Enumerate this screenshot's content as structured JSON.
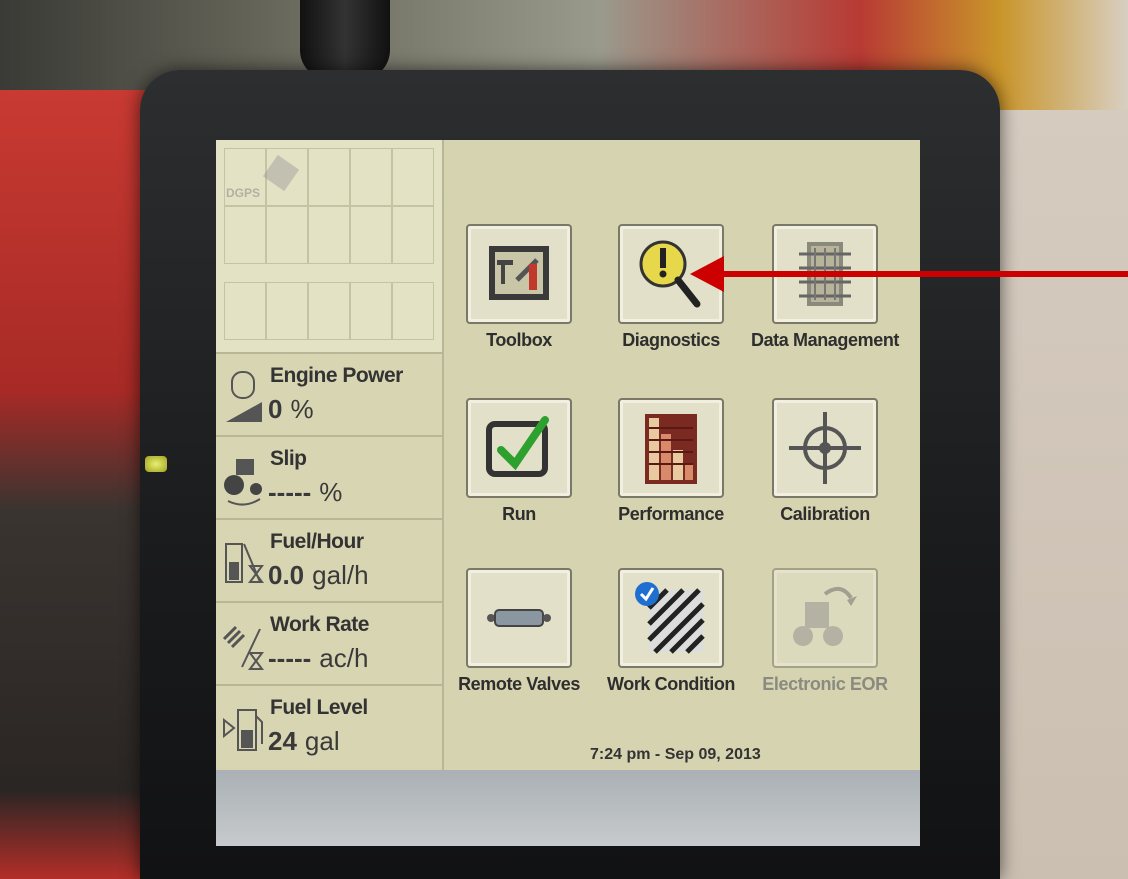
{
  "gps": {
    "label": "DGPS"
  },
  "metrics": [
    {
      "label": "Engine Power",
      "value": "0",
      "unit": "%",
      "icon": "engine-icon"
    },
    {
      "label": "Slip",
      "value": "-----",
      "unit": "%",
      "icon": "tractor-slip-icon"
    },
    {
      "label": "Fuel/Hour",
      "value": "0.0",
      "unit": "gal/h",
      "icon": "fuel-pump-hourglass-icon"
    },
    {
      "label": "Work Rate",
      "value": "-----",
      "unit": "ac/h",
      "icon": "field-hourglass-icon"
    },
    {
      "label": "Fuel Level",
      "value": "24",
      "unit": "gal",
      "icon": "fuel-pump-icon"
    }
  ],
  "tiles": [
    {
      "label": "Toolbox",
      "icon": "toolbox-icon"
    },
    {
      "label": "Diagnostics",
      "icon": "diagnostics-magnifier-icon"
    },
    {
      "label": "Data Management",
      "icon": "data-management-icon"
    },
    {
      "label": "Run",
      "icon": "run-checkmark-icon"
    },
    {
      "label": "Performance",
      "icon": "performance-chart-icon"
    },
    {
      "label": "Calibration",
      "icon": "calibration-crosshair-icon"
    },
    {
      "label": "Remote Valves",
      "icon": "remote-valve-icon"
    },
    {
      "label": "Work Condition",
      "icon": "work-condition-icon"
    },
    {
      "label": "Electronic EOR",
      "icon": "electronic-eor-icon"
    }
  ],
  "status": {
    "datetime": "7:24 pm - Sep 09, 2013"
  },
  "colors": {
    "annotation_arrow": "#cc0000",
    "screen_bg": "#d6d4b0"
  }
}
